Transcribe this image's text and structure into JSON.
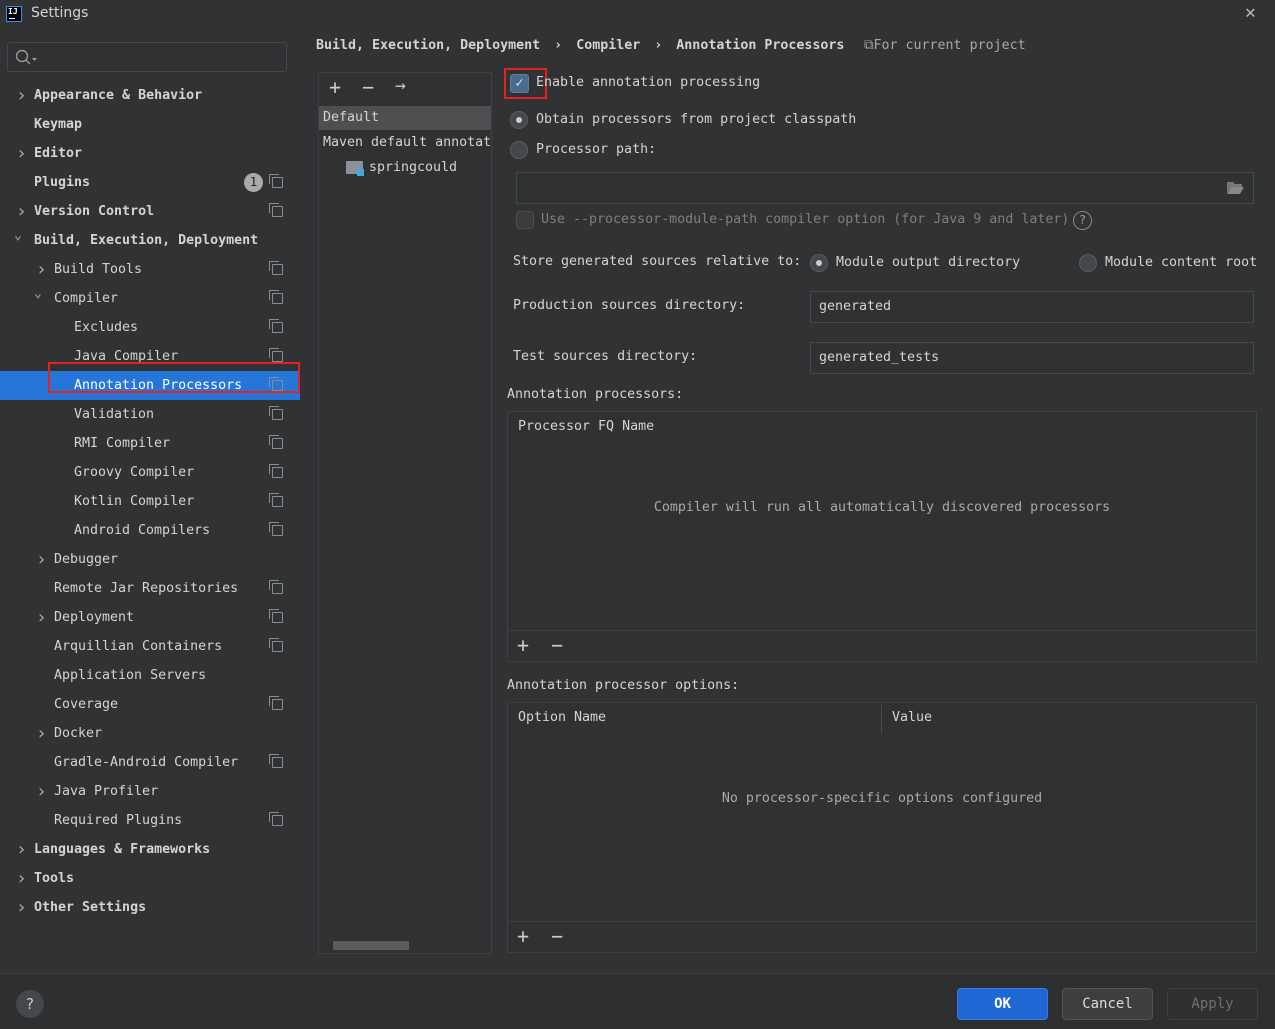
{
  "window": {
    "title": "Settings",
    "close_icon": "close-icon"
  },
  "search": {
    "placeholder": ""
  },
  "sidebar": {
    "items": [
      {
        "label": "Appearance & Behavior",
        "level": 0,
        "chevron": "right",
        "copy": false
      },
      {
        "label": "Keymap",
        "level": 0,
        "chevron": "",
        "copy": false
      },
      {
        "label": "Editor",
        "level": 0,
        "chevron": "right",
        "copy": false
      },
      {
        "label": "Plugins",
        "level": 0,
        "chevron": "",
        "copy": true,
        "badge": "1"
      },
      {
        "label": "Version Control",
        "level": 0,
        "chevron": "right",
        "copy": true
      },
      {
        "label": "Build, Execution, Deployment",
        "level": 0,
        "chevron": "down",
        "copy": false
      },
      {
        "label": "Build Tools",
        "level": 1,
        "chevron": "right",
        "copy": true
      },
      {
        "label": "Compiler",
        "level": 1,
        "chevron": "down",
        "copy": true
      },
      {
        "label": "Excludes",
        "level": 2,
        "chevron": "",
        "copy": true
      },
      {
        "label": "Java Compiler",
        "level": 2,
        "chevron": "",
        "copy": true
      },
      {
        "label": "Annotation Processors",
        "level": 2,
        "chevron": "",
        "copy": true,
        "selected": true
      },
      {
        "label": "Validation",
        "level": 2,
        "chevron": "",
        "copy": true
      },
      {
        "label": "RMI Compiler",
        "level": 2,
        "chevron": "",
        "copy": true
      },
      {
        "label": "Groovy Compiler",
        "level": 2,
        "chevron": "",
        "copy": true
      },
      {
        "label": "Kotlin Compiler",
        "level": 2,
        "chevron": "",
        "copy": true
      },
      {
        "label": "Android Compilers",
        "level": 2,
        "chevron": "",
        "copy": true
      },
      {
        "label": "Debugger",
        "level": 1,
        "chevron": "right",
        "copy": false
      },
      {
        "label": "Remote Jar Repositories",
        "level": 1,
        "chevron": "",
        "copy": true
      },
      {
        "label": "Deployment",
        "level": 1,
        "chevron": "right",
        "copy": true
      },
      {
        "label": "Arquillian Containers",
        "level": 1,
        "chevron": "",
        "copy": true
      },
      {
        "label": "Application Servers",
        "level": 1,
        "chevron": "",
        "copy": false
      },
      {
        "label": "Coverage",
        "level": 1,
        "chevron": "",
        "copy": true
      },
      {
        "label": "Docker",
        "level": 1,
        "chevron": "right",
        "copy": false
      },
      {
        "label": "Gradle-Android Compiler",
        "level": 1,
        "chevron": "",
        "copy": true
      },
      {
        "label": "Java Profiler",
        "level": 1,
        "chevron": "right",
        "copy": false
      },
      {
        "label": "Required Plugins",
        "level": 1,
        "chevron": "",
        "copy": true
      },
      {
        "label": "Languages & Frameworks",
        "level": 0,
        "chevron": "right",
        "copy": false
      },
      {
        "label": "Tools",
        "level": 0,
        "chevron": "right",
        "copy": false
      },
      {
        "label": "Other Settings",
        "level": 0,
        "chevron": "right",
        "copy": false
      }
    ]
  },
  "breadcrumb": {
    "items": [
      "Build, Execution, Deployment",
      "Compiler",
      "Annotation Processors"
    ],
    "separator": "›",
    "scope": "For current project"
  },
  "profiles": {
    "add": "+",
    "remove": "−",
    "move": "→",
    "items": [
      "Default",
      "Maven default annotat"
    ],
    "module": "springcould"
  },
  "settings": {
    "enable_label": "Enable annotation processing",
    "enable_checked": true,
    "obtain_label": "Obtain processors from project classpath",
    "path_label": "Processor path:",
    "path_value": "",
    "module_path_label": "Use --processor-module-path compiler option (for Java 9 and later)",
    "store_label": "Store generated sources relative to:",
    "store_output": "Module output directory",
    "store_content": "Module content root",
    "prod_label": "Production sources directory:",
    "prod_value": "generated",
    "test_label": "Test sources directory:",
    "test_value": "generated_tests",
    "processors_label": "Annotation processors:",
    "processors_header": "Processor FQ Name",
    "processors_empty": "Compiler will run all automatically discovered processors",
    "options_label": "Annotation processor options:",
    "options_headers": [
      "Option Name",
      "Value"
    ],
    "options_empty": "No processor-specific options configured",
    "add": "+",
    "remove": "−"
  },
  "footer": {
    "help": "?",
    "ok": "OK",
    "cancel": "Cancel",
    "apply": "Apply",
    "accent": "#2067d6"
  }
}
